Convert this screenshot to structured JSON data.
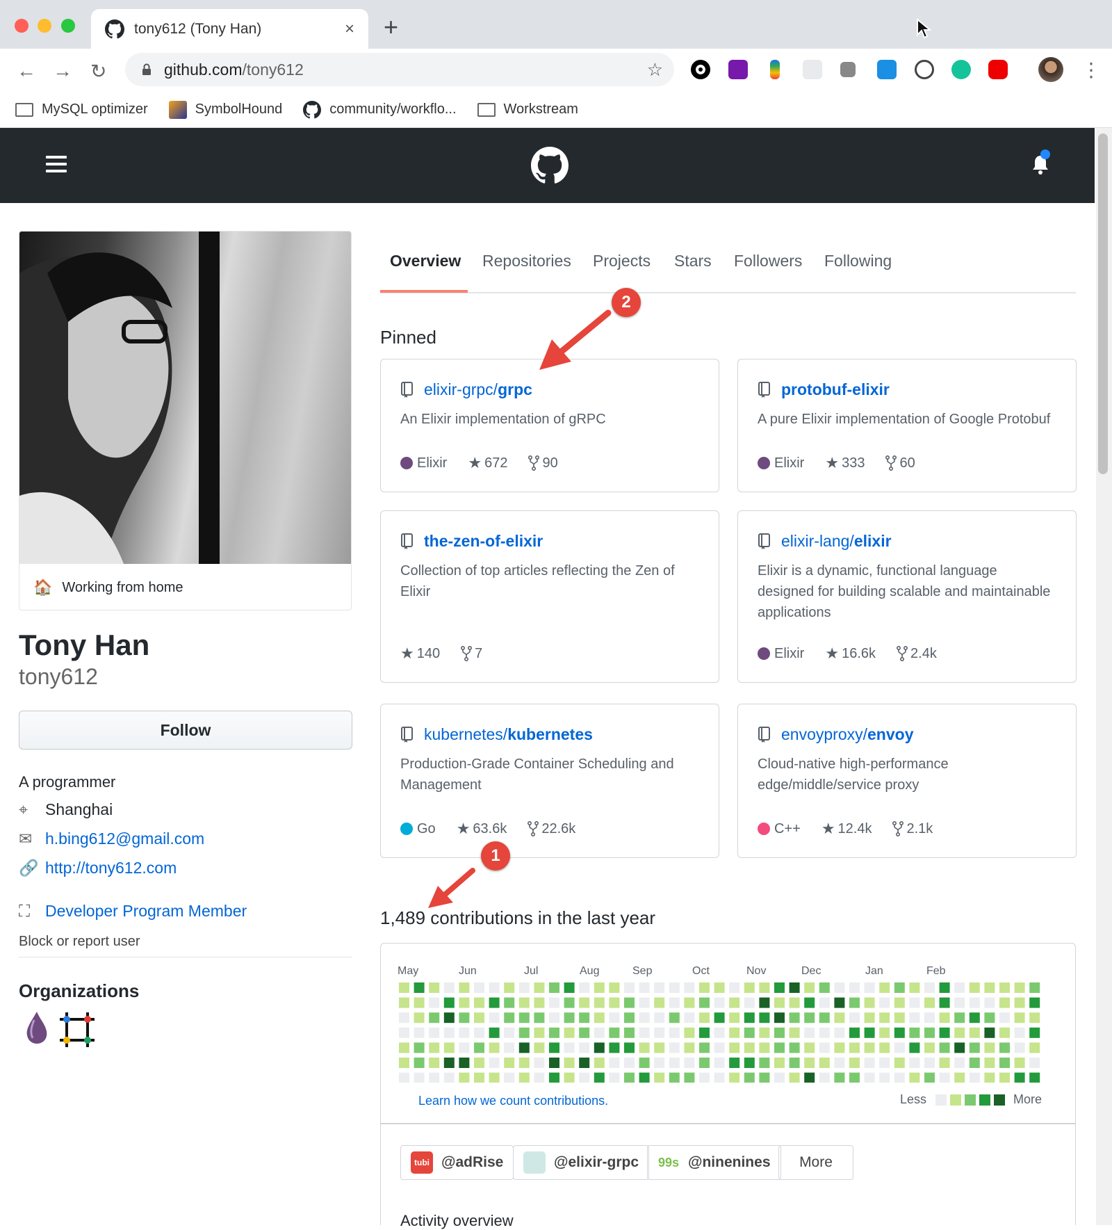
{
  "browser": {
    "tab_title": "tony612 (Tony Han)",
    "tab_close": "×",
    "new_tab": "+",
    "url_host": "github.com",
    "url_path": "/tony612",
    "bookmarks": [
      {
        "label": "MySQL optimizer",
        "icon": "folder-icon"
      },
      {
        "label": "SymbolHound",
        "icon": "symbolhound-icon"
      },
      {
        "label": "community/workflo...",
        "icon": "github-icon"
      },
      {
        "label": "Workstream",
        "icon": "folder-icon"
      }
    ]
  },
  "profile": {
    "status": "Working from home",
    "name": "Tony Han",
    "login": "tony612",
    "follow_label": "Follow",
    "bio": "A programmer",
    "location": "Shanghai",
    "email": "h.bing612@gmail.com",
    "website": "http://tony612.com",
    "developer": "Developer Program Member",
    "block": "Block or report user",
    "organizations_title": "Organizations"
  },
  "tabs": [
    "Overview",
    "Repositories",
    "Projects",
    "Stars",
    "Followers",
    "Following"
  ],
  "pinned_title": "Pinned",
  "pinned": [
    {
      "owner": "elixir-grpc/",
      "name": "grpc",
      "desc": "An Elixir implementation of gRPC",
      "lang": "Elixir",
      "lang_color": "#6e4a7e",
      "stars": "672",
      "forks": "90"
    },
    {
      "owner": "",
      "name": "protobuf-elixir",
      "desc": "A pure Elixir implementation of Google Protobuf",
      "lang": "Elixir",
      "lang_color": "#6e4a7e",
      "stars": "333",
      "forks": "60"
    },
    {
      "owner": "",
      "name": "the-zen-of-elixir",
      "desc": "Collection of top articles reflecting the Zen of Elixir",
      "lang": "",
      "lang_color": "",
      "stars": "140",
      "forks": "7"
    },
    {
      "owner": "elixir-lang/",
      "name": "elixir",
      "desc": "Elixir is a dynamic, functional language designed for building scalable and maintainable applications",
      "lang": "Elixir",
      "lang_color": "#6e4a7e",
      "stars": "16.6k",
      "forks": "2.4k"
    },
    {
      "owner": "kubernetes/",
      "name": "kubernetes",
      "desc": "Production-Grade Container Scheduling and Management",
      "lang": "Go",
      "lang_color": "#00ADD8",
      "stars": "63.6k",
      "forks": "22.6k"
    },
    {
      "owner": "envoyproxy/",
      "name": "envoy",
      "desc": "Cloud-native high-performance edge/middle/service proxy",
      "lang": "C++",
      "lang_color": "#f34b7d",
      "stars": "12.4k",
      "forks": "2.1k"
    }
  ],
  "contributions": {
    "title": "1,489 contributions in the last year",
    "months": [
      "May",
      "Jun",
      "Jul",
      "Aug",
      "Sep",
      "Oct",
      "Nov",
      "Dec",
      "Jan",
      "Feb"
    ],
    "learn_link": "Learn how we count contributions.",
    "less": "Less",
    "more": "More",
    "colors": [
      "#ebedf0",
      "#c6e48b",
      "#7bc96f",
      "#239a3b",
      "#196127"
    ]
  },
  "org_filters": [
    {
      "label": "@adRise",
      "icon_text": "tubi",
      "icon_color": "#e5453a"
    },
    {
      "label": "@elixir-grpc",
      "icon_text": "",
      "icon_color": "#cfe8e6"
    },
    {
      "label": "@ninenines",
      "icon_text": "99s",
      "icon_color": "#ffffff"
    }
  ],
  "more_label": "More",
  "activity_overview": "Activity overview",
  "annotations": [
    "1",
    "2"
  ]
}
